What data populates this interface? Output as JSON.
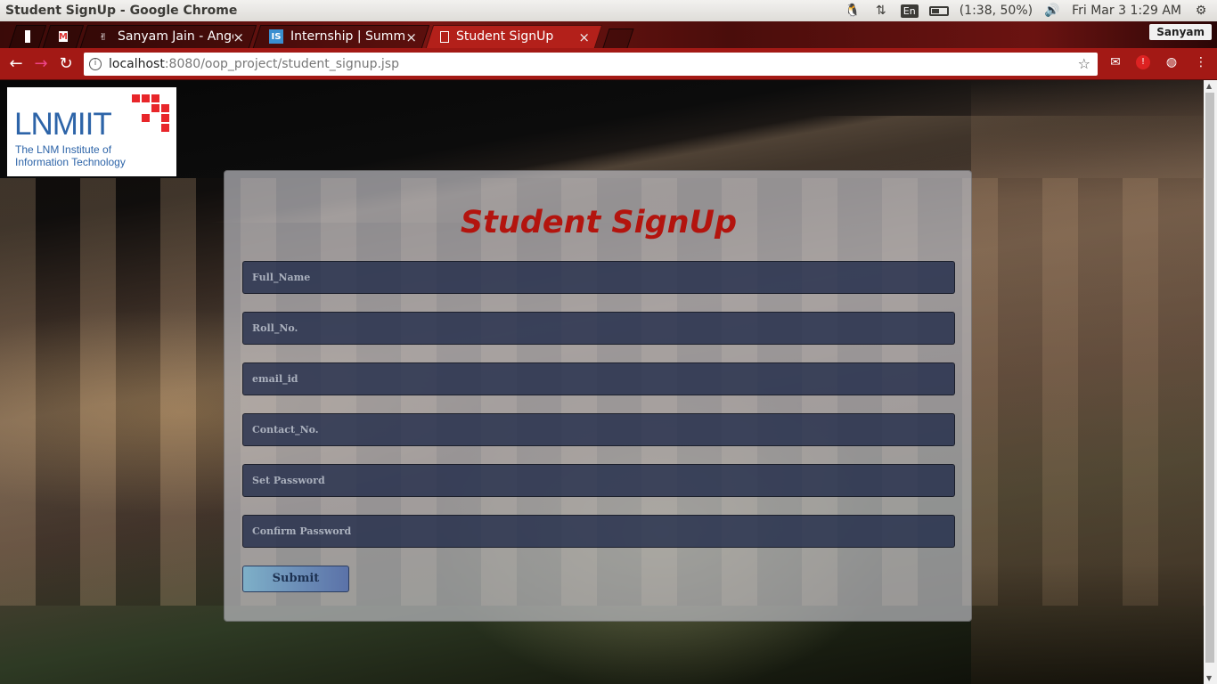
{
  "os": {
    "window_title": "Student SignUp - Google Chrome",
    "lang": "En",
    "battery": "(1:38, 50%)",
    "datetime": "Fri Mar  3  1:29 AM"
  },
  "browser": {
    "tabs": [
      {
        "label": ""
      },
      {
        "label": ""
      },
      {
        "label": "Sanyam Jain - AngelL"
      },
      {
        "label": "Internship | Summer"
      },
      {
        "label": "Student SignUp"
      }
    ],
    "profile": "Sanyam",
    "url_host": "localhost",
    "url_rest": ":8080/oop_project/student_signup.jsp"
  },
  "logo": {
    "main": "LNMIIT",
    "line1": "The LNM Institute of",
    "line2": "Information Technology"
  },
  "form": {
    "heading": "Student SignUp",
    "fields": [
      {
        "placeholder": "Full_Name"
      },
      {
        "placeholder": "Roll_No."
      },
      {
        "placeholder": "email_id"
      },
      {
        "placeholder": "Contact_No."
      },
      {
        "placeholder": "Set Password"
      },
      {
        "placeholder": "Confirm Password"
      }
    ],
    "submit_label": "Submit"
  },
  "colors": {
    "heading": "#b3140e",
    "chrome_frame": "#a31915",
    "logo_blue": "#2d64a8",
    "logo_red": "#e8262a"
  }
}
